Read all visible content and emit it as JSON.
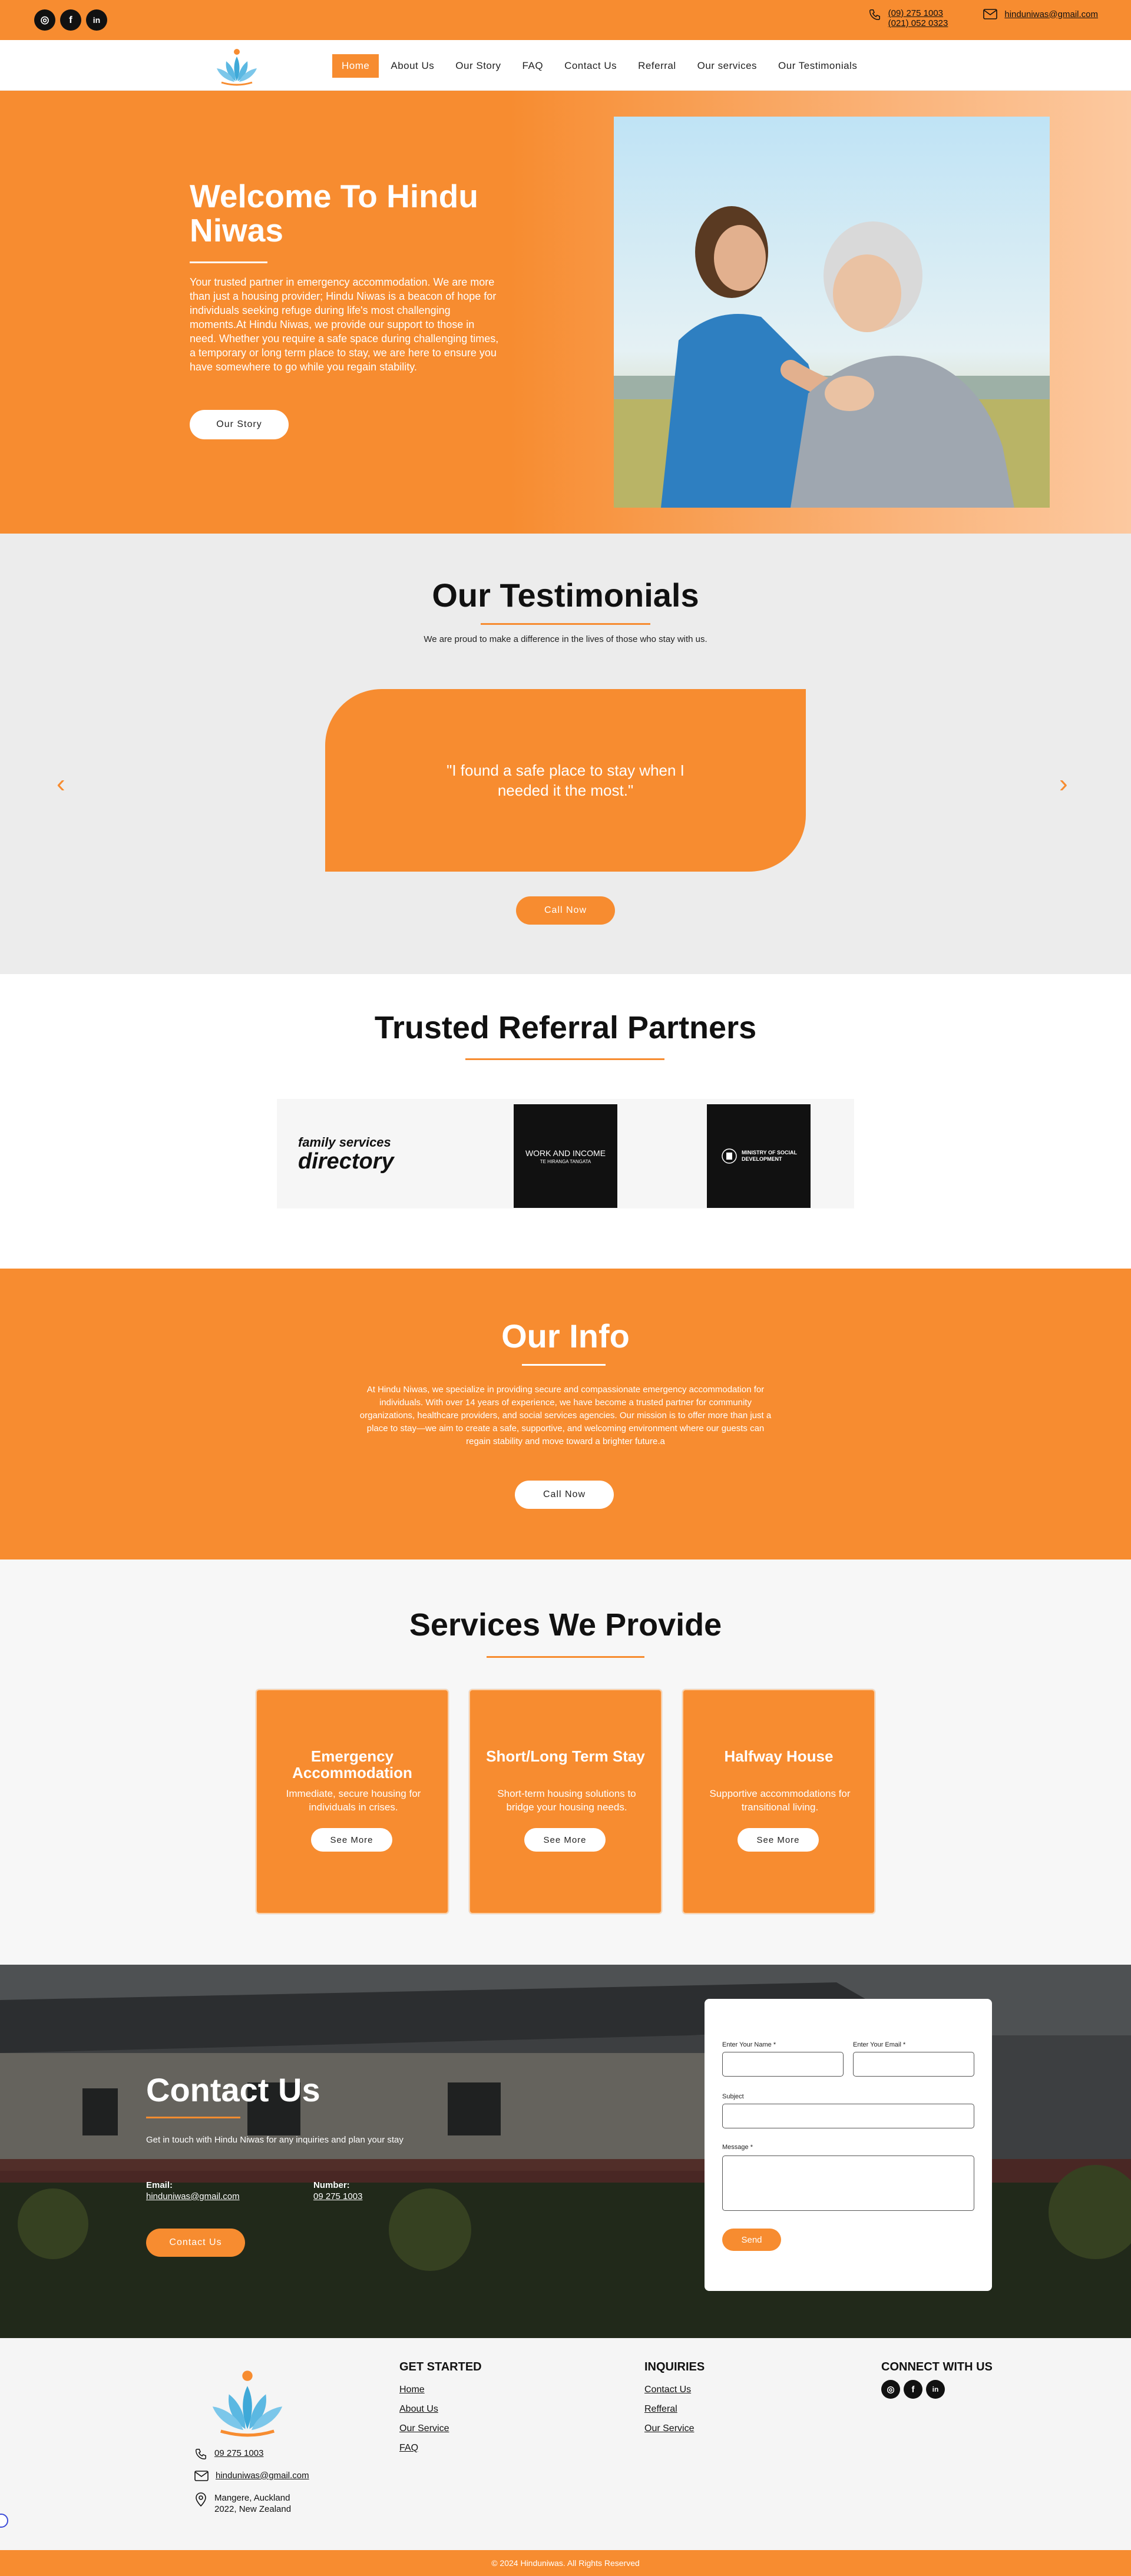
{
  "colors": {
    "accent": "#F78C30",
    "dark": "#111111",
    "white": "#FFFFFF",
    "section_gray": "#ECECEC"
  },
  "topbar": {
    "social": [
      {
        "icon": "instagram-icon",
        "glyph": "◎"
      },
      {
        "icon": "facebook-icon",
        "glyph": "f"
      },
      {
        "icon": "linkedin-icon",
        "glyph": "in"
      }
    ],
    "phone_1": "(09) 275 1003",
    "phone_2": "(021) 052 0323",
    "email": "hinduniwas@gmail.com"
  },
  "nav": {
    "items": [
      {
        "label": "Home",
        "active": true
      },
      {
        "label": "About Us"
      },
      {
        "label": "Our Story"
      },
      {
        "label": "FAQ"
      },
      {
        "label": "Contact Us"
      },
      {
        "label": "Referral"
      },
      {
        "label": "Our services"
      },
      {
        "label": "Our Testimonials"
      }
    ]
  },
  "hero": {
    "title": "Welcome To Hindu Niwas",
    "text": "Your trusted partner in emergency accommodation. We are more than just a housing provider; Hindu Niwas is a beacon of hope for individuals seeking refuge during life's most challenging moments.At Hindu Niwas, we provide our support to those in need. Whether you require a safe space during challenging times, a temporary or long term place to stay, we are here to ensure you have somewhere to go while you regain stability.",
    "button": "Our Story"
  },
  "testimonials": {
    "title": "Our Testimonials",
    "subtitle": "We are proud to make a difference in the lives of those who stay with us.",
    "quote": "\"I found a safe place to stay when I needed it the most.\"",
    "prev": "‹",
    "next": "›",
    "button": "Call Now"
  },
  "partners": {
    "title": "Trusted Referral Partners",
    "logos": [
      {
        "line1": "family services",
        "line2": "directory"
      },
      {
        "line1": "WORK AND INCOME",
        "line2": "TE HIRANGA TANGATA"
      },
      {
        "line1": "MINISTRY OF SOCIAL",
        "line2": "DEVELOPMENT"
      }
    ]
  },
  "info": {
    "title": "Our Info",
    "text": "At Hindu Niwas, we specialize in providing secure and compassionate emergency accommodation for individuals. With over 14 years of experience, we have become a trusted partner for community organizations, healthcare providers, and social services agencies. Our mission is to offer more than just a place to stay—we aim to create a safe, supportive, and welcoming environment where our guests can regain stability and move toward a brighter future.a",
    "button": "Call Now"
  },
  "services": {
    "title": "Services We Provide",
    "cards": [
      {
        "title": "Emergency Accommodation",
        "desc": "Immediate, secure housing for individuals in crises.",
        "button": "See More"
      },
      {
        "title": "Short/Long Term Stay",
        "desc": "Short-term housing solutions to bridge your housing needs.",
        "button": "See More"
      },
      {
        "title": "Halfway House",
        "desc": "Supportive accommodations for transitional living.",
        "button": "See More"
      }
    ]
  },
  "contact": {
    "title": "Contact Us",
    "intro": "Get in touch with Hindu Niwas for any inquiries and plan your stay",
    "email_label": "Email:",
    "email": "hinduniwas@gmail.com",
    "number_label": "Number:",
    "number": "09 275 1003",
    "button": "Contact Us",
    "form": {
      "name_label": "Enter Your Name *",
      "email_label": "Enter Your Email *",
      "subject_label": "Subject",
      "message_label": "Message  *",
      "send": "Send"
    }
  },
  "footer": {
    "phone": "09 275 1003",
    "email": "hinduniwas@gmail.com",
    "address": "Mangere, Auckland 2022, New Zealand",
    "get_started": {
      "title": "GET STARTED",
      "links": [
        "Home",
        "About Us",
        "Our Service",
        "FAQ"
      ]
    },
    "inquiries": {
      "title": "INQUIRIES",
      "links": [
        "Contact Us",
        "Refferal",
        "Our Service"
      ]
    },
    "connect": {
      "title": "CONNECT WITH US"
    },
    "copyright": "© 2024 Hinduniwas. All Rights Reserved"
  }
}
